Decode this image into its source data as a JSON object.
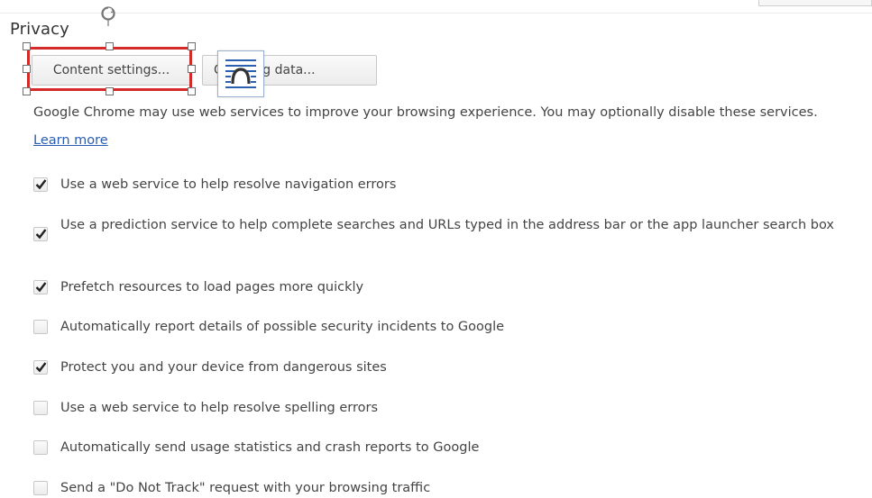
{
  "section": {
    "title": "Privacy"
  },
  "buttons": {
    "content_settings": "Content settings...",
    "clear_browsing_data": "C    owsing data..."
  },
  "description": {
    "text": "Google Chrome may use web services to improve your browsing experience. You may optionally disable these services. ",
    "learn_more": "Learn more"
  },
  "options": [
    {
      "label": "Use a web service to help resolve navigation errors",
      "checked": true
    },
    {
      "label": "Use a prediction service to help complete searches and URLs typed in the address bar or the app launcher search box",
      "checked": true
    },
    {
      "label": "Prefetch resources to load pages more quickly",
      "checked": true
    },
    {
      "label": "Automatically report details of possible security incidents to Google",
      "checked": false
    },
    {
      "label": "Protect you and your device from dangerous sites",
      "checked": true
    },
    {
      "label": "Use a web service to help resolve spelling errors",
      "checked": false
    },
    {
      "label": "Automatically send usage statistics and crash reports to Google",
      "checked": false
    },
    {
      "label": "Send a \"Do Not Track\" request with your browsing traffic",
      "checked": false
    }
  ],
  "colors": {
    "selection_border": "#d42a2a",
    "link": "#2a5db0",
    "text": "#444444",
    "overlay_icon_accent": "#2b5fb0"
  },
  "icons": {
    "rotate_handle": "rotate-handle-icon",
    "overlay": "text-wrap-icon",
    "check": "check-icon"
  }
}
